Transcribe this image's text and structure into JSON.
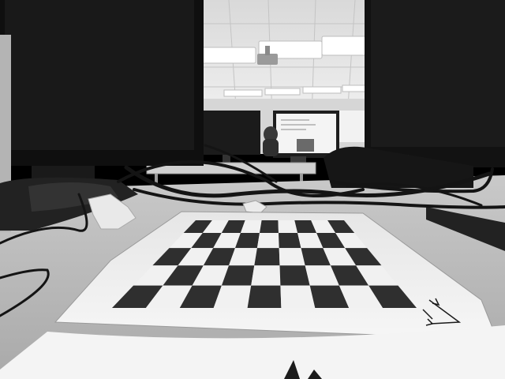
{
  "image": {
    "color_mode": "grayscale",
    "subjects": [
      "computer-monitor",
      "checkerboard-calibration-pattern",
      "cables",
      "desk",
      "office-ceiling-lights"
    ]
  },
  "checkerboard": {
    "rows": 5,
    "cols": 9,
    "dark_color": "#2f2f2f",
    "light_color": "#f1f1f1",
    "has_axis_marker": true
  },
  "palette": {
    "ceiling": "#e2e2e2",
    "desk": "#b8b8b8",
    "monitor_bezel": "#111111",
    "paper": "#efefef"
  }
}
